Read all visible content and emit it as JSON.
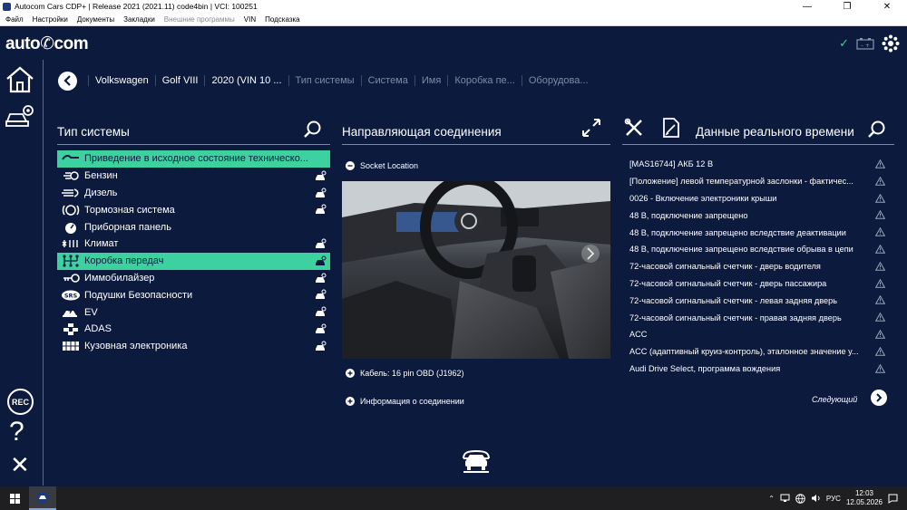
{
  "window": {
    "title": "Autocom Cars CDP+ | Release 2021 (2021.11) code4bin | VCI: 100251",
    "controls": [
      "—",
      "❐",
      "✕"
    ]
  },
  "menu": [
    {
      "label": "Файл",
      "enabled": true
    },
    {
      "label": "Настройки",
      "enabled": true
    },
    {
      "label": "Документы",
      "enabled": true
    },
    {
      "label": "Закладки",
      "enabled": true
    },
    {
      "label": "Внешние программы",
      "enabled": false
    },
    {
      "label": "VIN",
      "enabled": true
    },
    {
      "label": "Подсказка",
      "enabled": true
    }
  ],
  "brand": {
    "logo": "auto✆com",
    "accent": "#3ed1a0",
    "background": "#0c1a3d"
  },
  "breadcrumb": [
    {
      "label": "Volkswagen",
      "active": true
    },
    {
      "label": "Golf VIII",
      "active": true
    },
    {
      "label": "2020 (VIN 10 ...",
      "active": true
    },
    {
      "label": "Тип системы",
      "active": false
    },
    {
      "label": "Система",
      "active": false
    },
    {
      "label": "Имя",
      "active": false
    },
    {
      "label": "Коробка пе...",
      "active": false
    },
    {
      "label": "Оборудова...",
      "active": false
    }
  ],
  "systems_panel": {
    "title": "Тип системы",
    "items": [
      {
        "label": "Приведение в исходное состояние техническо...",
        "icon": "wrench-icon",
        "selected": true,
        "has_car": false
      },
      {
        "label": "Бензин",
        "icon": "gasoline-icon",
        "selected": false,
        "has_car": true
      },
      {
        "label": "Дизель",
        "icon": "diesel-glow-icon",
        "selected": false,
        "has_car": true
      },
      {
        "label": "Тормозная система",
        "icon": "brake-icon",
        "selected": false,
        "has_car": true
      },
      {
        "label": "Приборная панель",
        "icon": "gauge-icon",
        "selected": false,
        "has_car": false
      },
      {
        "label": "Климат",
        "icon": "climate-icon",
        "selected": false,
        "has_car": true
      },
      {
        "label": "Коробка передач",
        "icon": "gearbox-icon",
        "selected": true,
        "has_car": true
      },
      {
        "label": "Иммобилайзер",
        "icon": "key-icon",
        "selected": false,
        "has_car": true
      },
      {
        "label": "Подушки Безопасности",
        "icon": "airbag-icon",
        "icon_text": "SRS",
        "selected": false,
        "has_car": true
      },
      {
        "label": "EV",
        "icon": "ev-icon",
        "selected": false,
        "has_car": true
      },
      {
        "label": "ADAS",
        "icon": "adas-icon",
        "selected": false,
        "has_car": true
      },
      {
        "label": "Кузовная электроника",
        "icon": "body-electronics-icon",
        "selected": false,
        "has_car": true
      }
    ]
  },
  "connection_panel": {
    "title": "Направляющая соединения",
    "socket_label": "Socket Location",
    "cable_label": "Кабель: 16 pin OBD (J1962)",
    "info_label": "Информация о соединении"
  },
  "realtime_panel": {
    "title": "Данные реального времени",
    "items": [
      "[MAS16744] АКБ 12 В",
      "[Положение] левой температурной заслонки - фактичес...",
      "0026 - Включение электроники крыши",
      "48 В, подключение запрещено",
      "48 В, подключение запрещено вследствие деактивации",
      "48 В, подключение запрещено вследствие обрыва в цепи",
      "72-часовой сигнальный счетчик - дверь водителя",
      "72-часовой сигнальный счетчик - дверь пассажира",
      "72-часовой сигнальный счетчик - левая задняя дверь",
      "72-часовой сигнальный счетчик - правая задняя дверь",
      "ACC",
      "ACC (адаптивный круиз-контроль), эталонное значение у...",
      "Audi Drive Select, программа вождения"
    ],
    "next_label": "Следующий"
  },
  "rail": {
    "rec_label": "REC"
  },
  "taskbar": {
    "language": "РУС",
    "time": "12:03",
    "date": "12.05.2026"
  }
}
